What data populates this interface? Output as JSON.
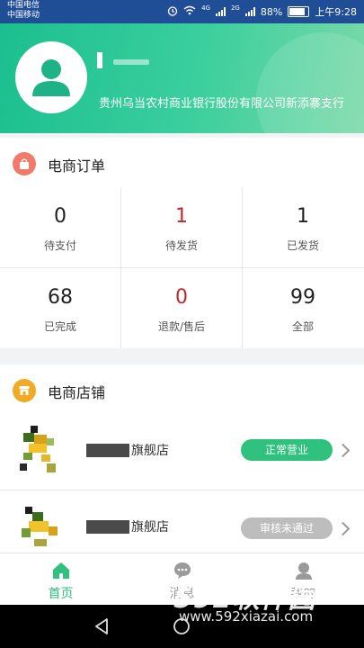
{
  "status_bar": {
    "carrier1": "中国电信",
    "carrier2": "中国移动",
    "network1": "4G",
    "network2": "2G",
    "battery": "88%",
    "time": "上午9:28"
  },
  "profile": {
    "bank_name": "贵州乌当农村商业银行股份有限公司新添寨支行"
  },
  "orders": {
    "title": "电商订单",
    "cells": [
      {
        "count": "0",
        "label": "待支付"
      },
      {
        "count": "1",
        "label": "待发货"
      },
      {
        "count": "1",
        "label": "已发货"
      },
      {
        "count": "68",
        "label": "已完成"
      },
      {
        "count": "0",
        "label": "退款/售后"
      },
      {
        "count": "99",
        "label": "全部"
      }
    ],
    "count_colors": [
      "#222222",
      "#c0282b",
      "#222222",
      "#222222",
      "#c0282b",
      "#222222"
    ]
  },
  "shops": {
    "title": "电商店铺",
    "items": [
      {
        "name_suffix": "旗舰店",
        "status": "正常营业",
        "status_color": "#2ec27e"
      },
      {
        "name_suffix": "旗舰店",
        "status": "审核未通过",
        "status_color": "#bdbdbd"
      }
    ]
  },
  "nav": {
    "items": [
      {
        "label": "首页",
        "icon": "home-icon",
        "active": true
      },
      {
        "label": "消息",
        "icon": "chat-icon",
        "active": false
      },
      {
        "label": "我的",
        "icon": "person-icon",
        "active": false
      }
    ],
    "active_color": "#2ec27e"
  },
  "watermark": {
    "brand": "592软件园",
    "url": "www.592xiazai.com"
  }
}
